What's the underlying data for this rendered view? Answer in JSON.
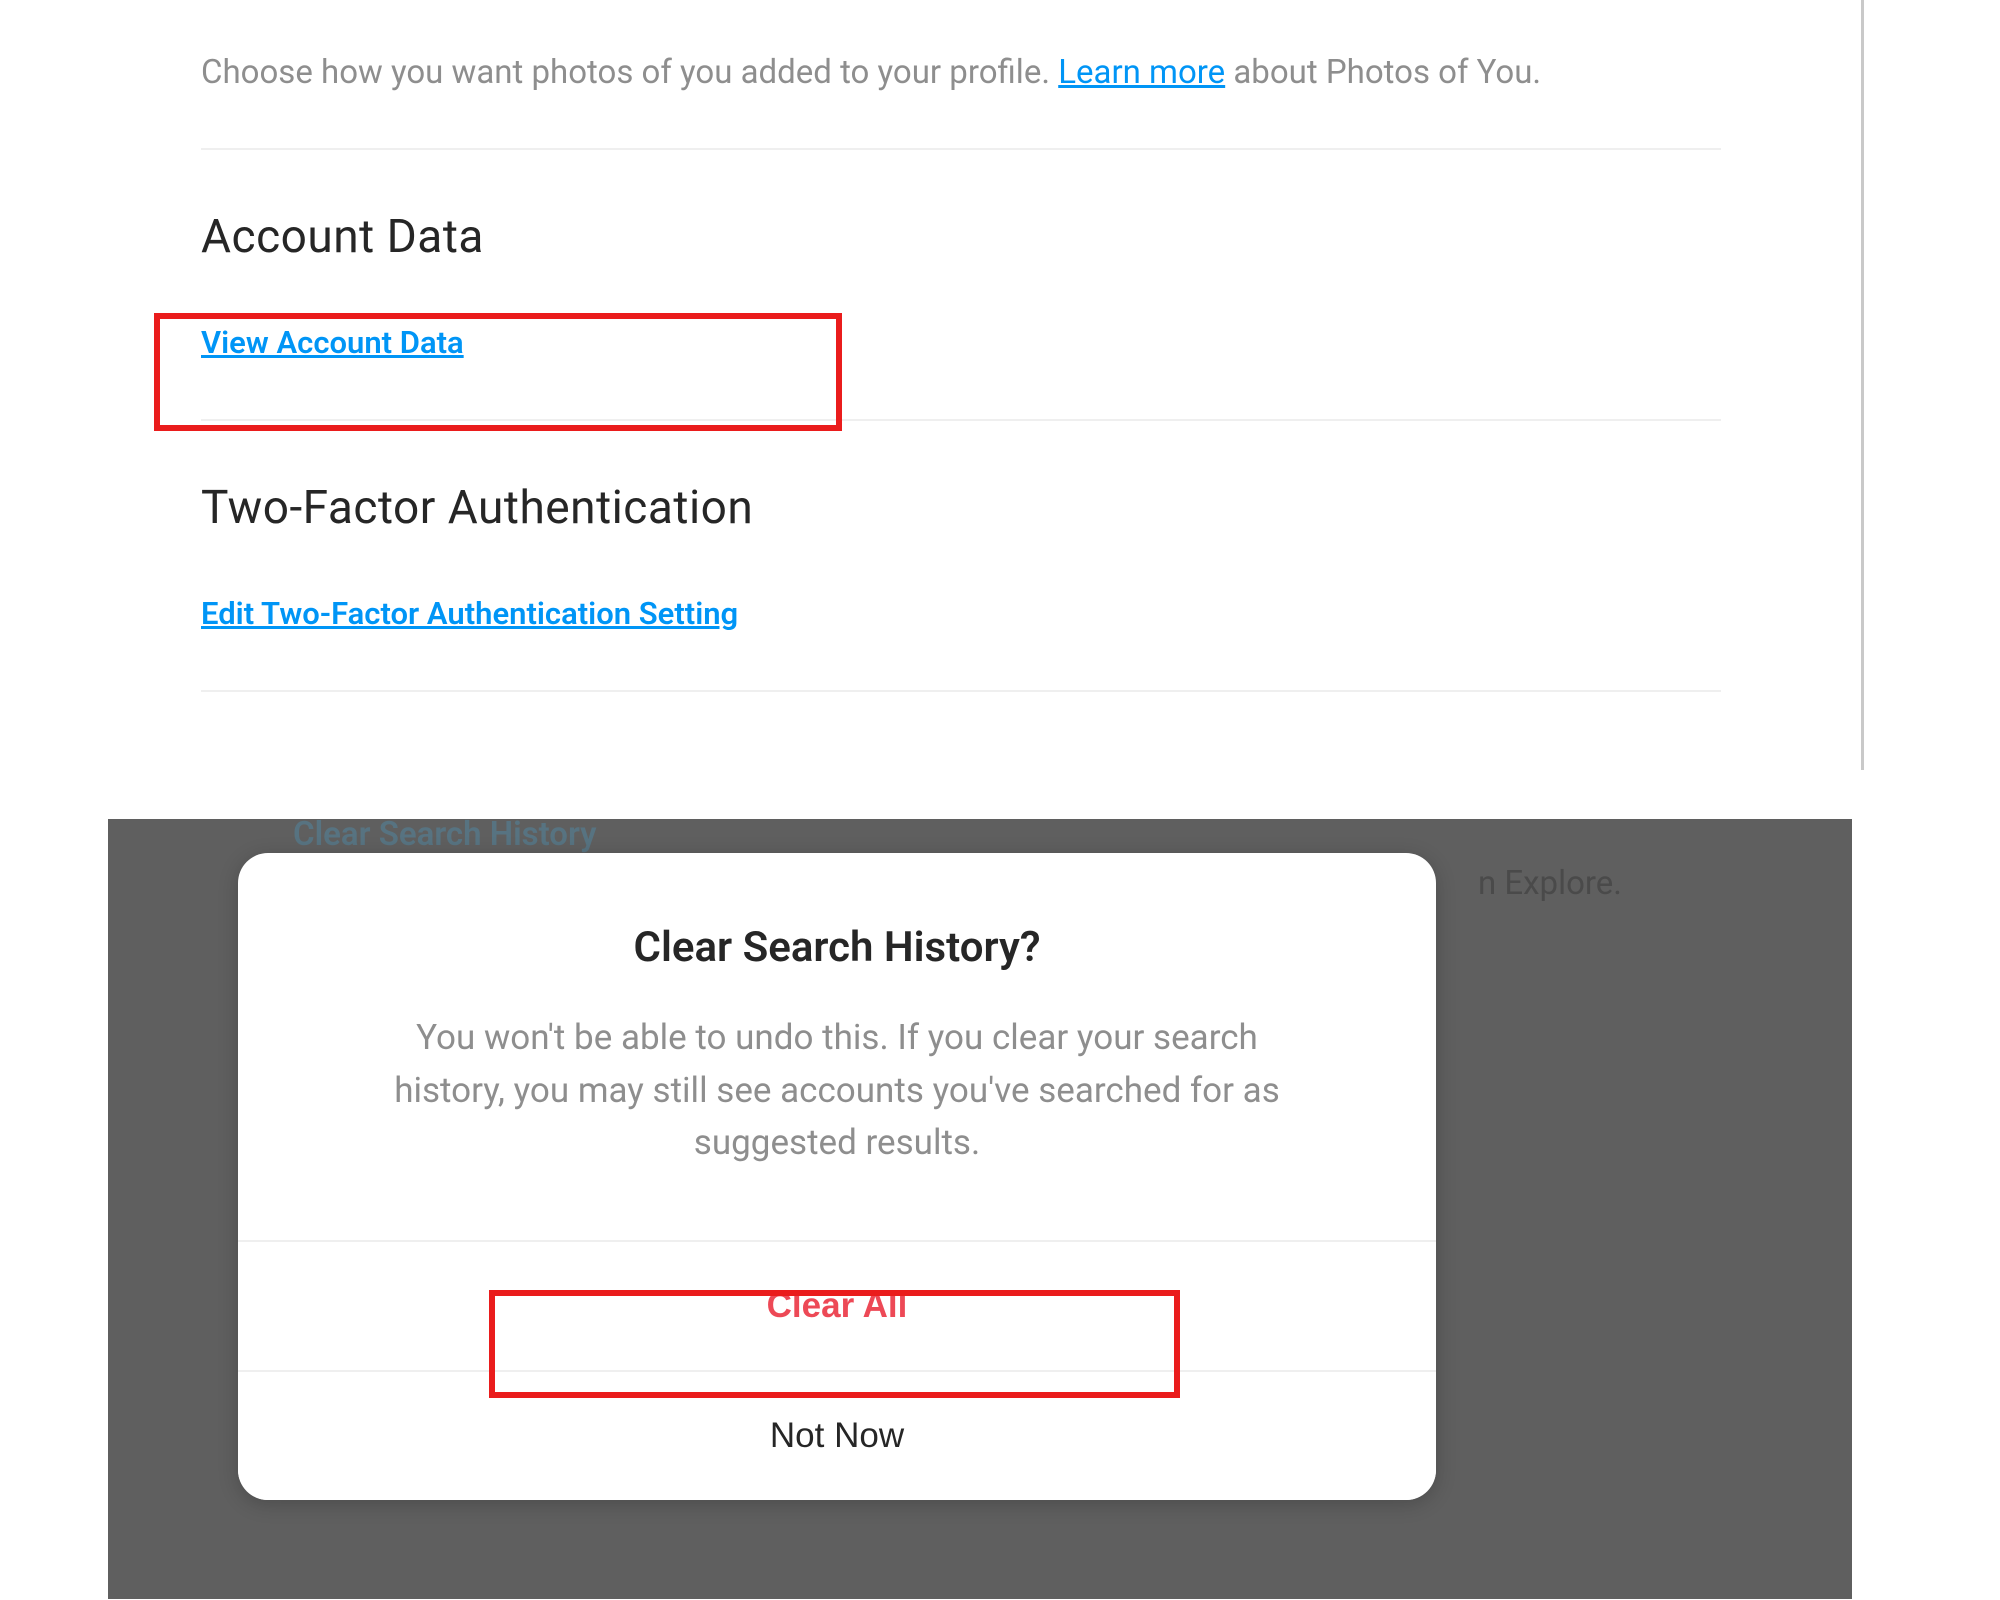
{
  "photos_of_you": {
    "description_prefix": "Choose how you want photos of you added to your profile. ",
    "learn_more_label": "Learn more",
    "description_suffix": " about Photos of You."
  },
  "account_data": {
    "heading": "Account Data",
    "link_label": "View Account Data"
  },
  "two_factor": {
    "heading": "Two-Factor Authentication",
    "link_label": "Edit Two-Factor Authentication Setting"
  },
  "background": {
    "clear_search_link": "Clear Search History",
    "explore_fragment": "n Explore."
  },
  "dialog": {
    "title": "Clear Search History?",
    "message": "You won't be able to undo this. If you clear your search history, you may still see accounts you've searched for as suggested results.",
    "clear_all_label": "Clear All",
    "not_now_label": "Not Now"
  }
}
